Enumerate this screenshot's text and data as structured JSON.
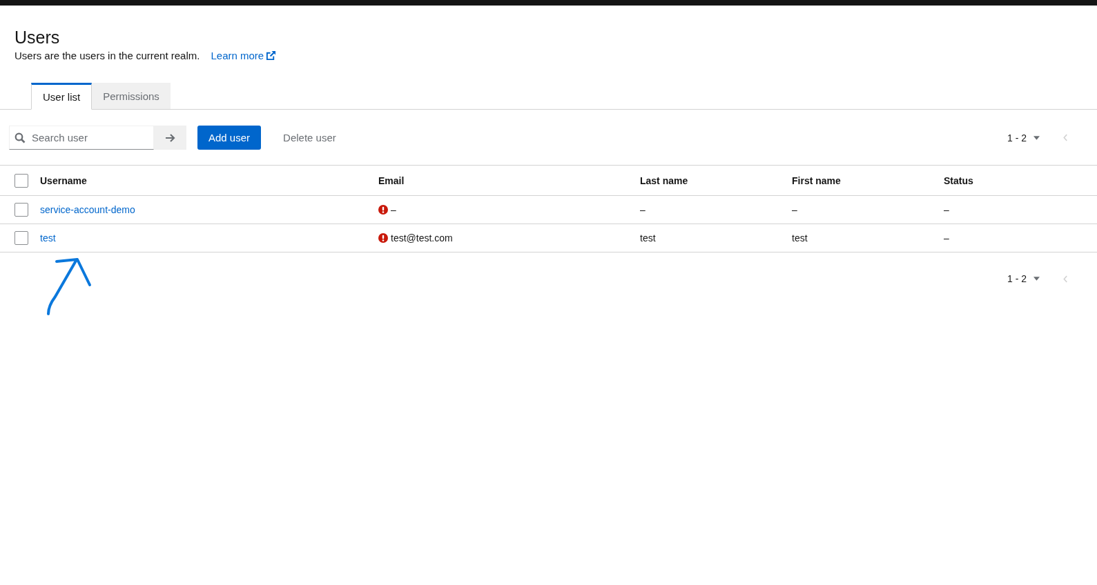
{
  "page": {
    "title": "Users",
    "description": "Users are the users in the current realm.",
    "learn_more": "Learn more"
  },
  "tabs": [
    {
      "label": "User list",
      "selected": true
    },
    {
      "label": "Permissions",
      "selected": false
    }
  ],
  "toolbar": {
    "search": {
      "placeholder": "Search user"
    },
    "buttons": [
      {
        "label": "Add user",
        "kind": "primary"
      },
      {
        "label": "Delete user",
        "kind": "link"
      }
    ]
  },
  "pagination_top": {
    "range": "1 - 2",
    "prev_disabled": true
  },
  "table": {
    "columns": [
      "Username",
      "Email",
      "Last name",
      "First name",
      "Status"
    ],
    "select_all_checked": false,
    "rows": [
      {
        "checked": false,
        "username": "service-account-demo",
        "email": "–",
        "email_warning": true,
        "last_name": "–",
        "first_name": "–",
        "status": "–"
      },
      {
        "checked": false,
        "username": "test",
        "email": "test@test.com",
        "email_warning": true,
        "last_name": "test",
        "first_name": "test",
        "status": "–"
      }
    ]
  },
  "pagination_bottom": {
    "range": "1 - 2",
    "prev_disabled": true
  }
}
